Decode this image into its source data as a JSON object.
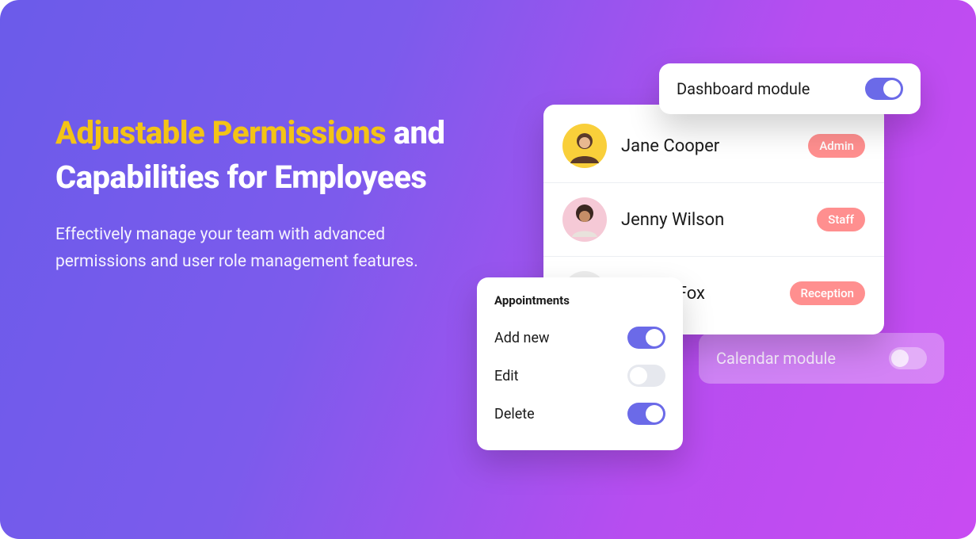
{
  "headline": {
    "accent": "Adjustable Permissions",
    "rest": "and Capabilities for Employees"
  },
  "subhead": "Effectively manage your team with advanced permissions and user role management features.",
  "dashboard_module": {
    "label": "Dashboard module",
    "on": true
  },
  "calendar_module": {
    "label": "Calendar module",
    "on": false
  },
  "users": [
    {
      "name": "Jane Cooper",
      "role": "Admin"
    },
    {
      "name": "Jenny Wilson",
      "role": "Staff"
    },
    {
      "name": "Robert Fox",
      "role": "Reception"
    }
  ],
  "appointments": {
    "title": "Appointments",
    "perms": [
      {
        "label": "Add new",
        "on": true
      },
      {
        "label": "Edit",
        "on": false
      },
      {
        "label": "Delete",
        "on": true
      }
    ]
  },
  "colors": {
    "accent_yellow": "#F3C316",
    "toggle_on": "#6B6AE8",
    "role_pill": "#FF8F8F"
  }
}
